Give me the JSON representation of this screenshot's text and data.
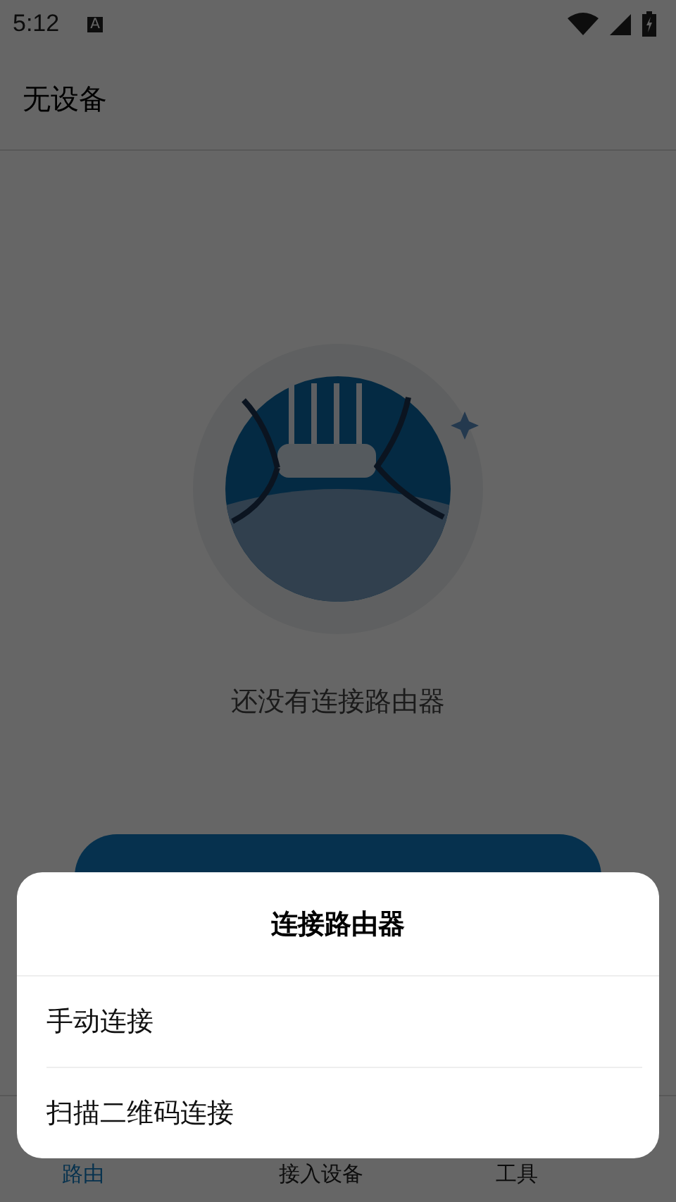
{
  "status_bar": {
    "time": "5:12",
    "notification_glyph": "A"
  },
  "app_bar": {
    "title": "无设备"
  },
  "empty_state": {
    "message": "还没有连接路由器"
  },
  "bottom_nav": [
    {
      "label": "路由",
      "selected": true
    },
    {
      "label": "接入设备",
      "selected": false
    },
    {
      "label": "工具",
      "selected": false
    }
  ],
  "sheet": {
    "title": "连接路由器",
    "options": [
      "手动连接",
      "扫描二维码连接"
    ]
  }
}
